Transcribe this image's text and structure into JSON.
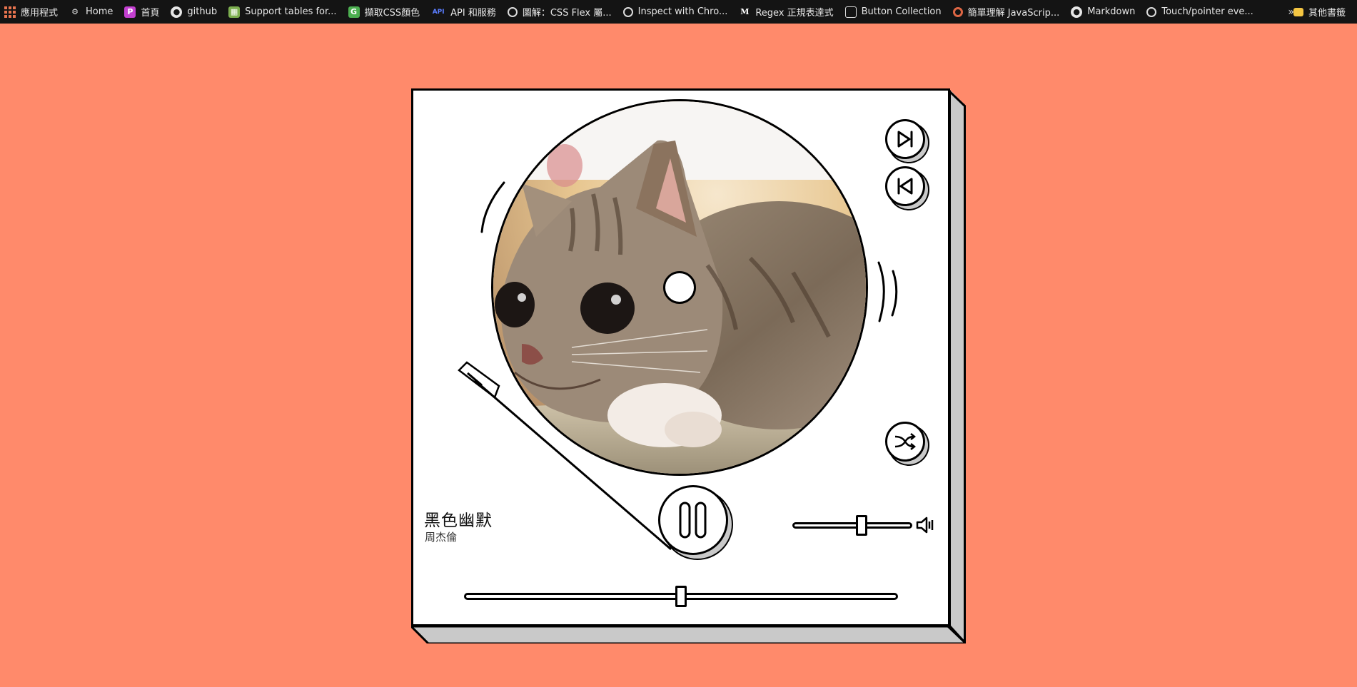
{
  "bookmarks": {
    "items": [
      {
        "label": "應用程式",
        "icon": "apps-grid-icon"
      },
      {
        "label": "Home",
        "icon": "gear-icon"
      },
      {
        "label": "首頁",
        "icon": "p-logo-icon"
      },
      {
        "label": "github",
        "icon": "github-icon"
      },
      {
        "label": "Support tables for...",
        "icon": "caniuse-icon"
      },
      {
        "label": "擷取CSS顏色",
        "icon": "g-logo-icon"
      },
      {
        "label": "API 和服務",
        "icon": "api-icon"
      },
      {
        "label": "圖解：CSS Flex 屬...",
        "icon": "globe-icon"
      },
      {
        "label": "Inspect with Chro...",
        "icon": "globe-icon"
      },
      {
        "label": "Regex 正規表達式",
        "icon": "m-logo-icon"
      },
      {
        "label": "Button Collection",
        "icon": "codepen-icon"
      },
      {
        "label": "簡單理解 JavaScrip...",
        "icon": "chrome-icon"
      },
      {
        "label": "Markdown",
        "icon": "github-icon"
      },
      {
        "label": "Touch/pointer eve...",
        "icon": "globe-icon"
      }
    ],
    "more_label": "»",
    "other_label": "其他書籤"
  },
  "player": {
    "song_title": "黑色幽默",
    "artist": "周杰倫",
    "cover_icon": "kitten-photo",
    "buttons": {
      "next": "next-track-icon",
      "previous": "previous-track-icon",
      "shuffle": "shuffle-icon",
      "play_pause": "pause-icon",
      "volume": "volume-icon"
    },
    "volume_level": 0.58,
    "progress_level": 0.5
  }
}
